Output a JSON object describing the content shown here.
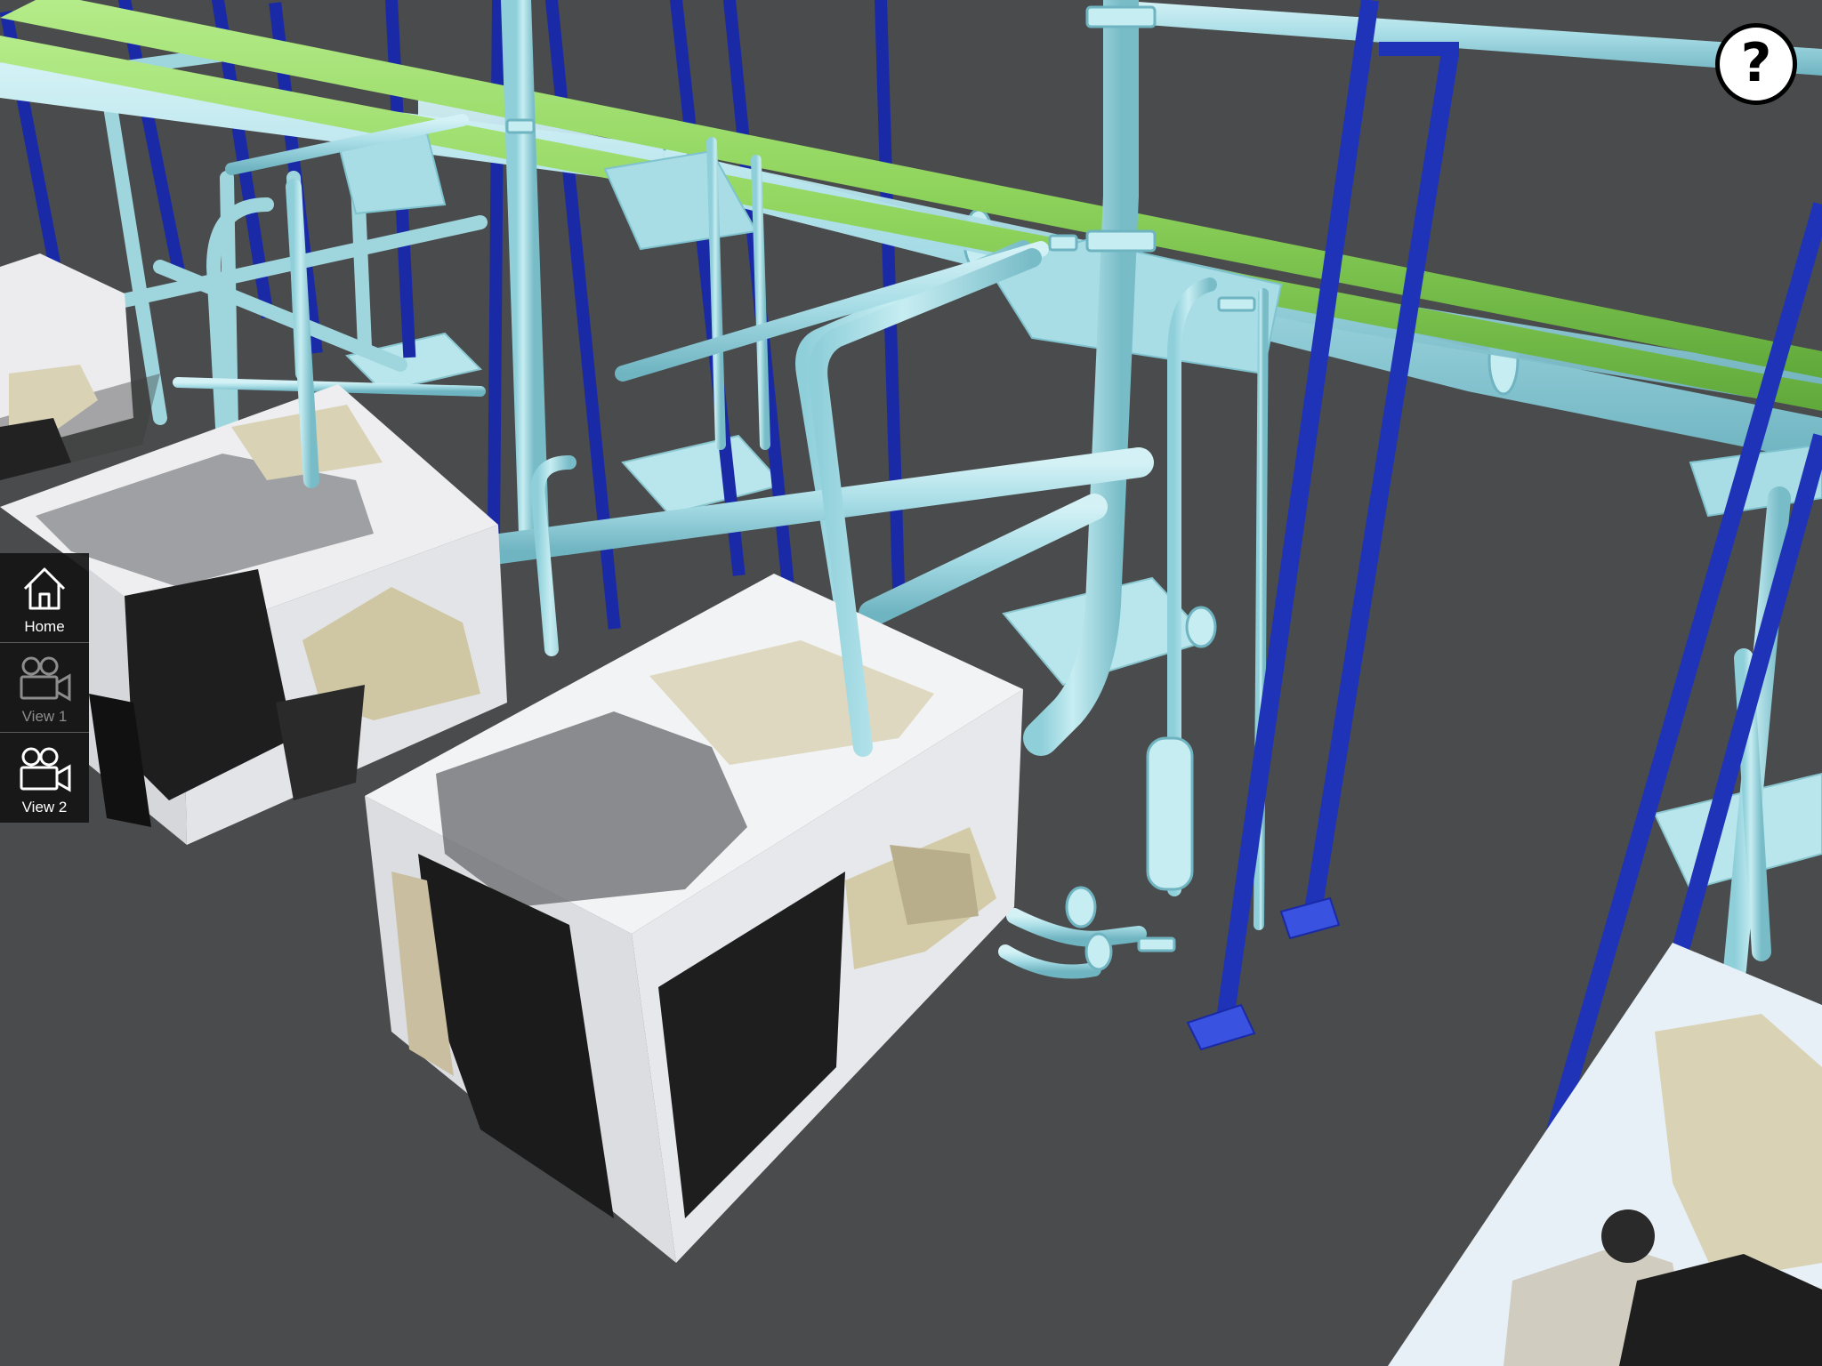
{
  "nav": {
    "items": [
      {
        "label": "Home",
        "icon": "home-icon",
        "active": true
      },
      {
        "label": "View 1",
        "icon": "camera-icon",
        "active": false
      },
      {
        "label": "View 2",
        "icon": "camera-icon",
        "active": true
      }
    ]
  },
  "help": {
    "glyph": "?",
    "icon": "help-icon"
  },
  "colors": {
    "background": "#4a4b4c",
    "pipe": "#a8dde6",
    "pipe_shade": "#7fc3cf",
    "green_pipe": "#8fd45c",
    "steel": "#1f33b8",
    "box_white": "#f2f3f4",
    "box_side": "#d9dadd",
    "panel": "#141414"
  }
}
